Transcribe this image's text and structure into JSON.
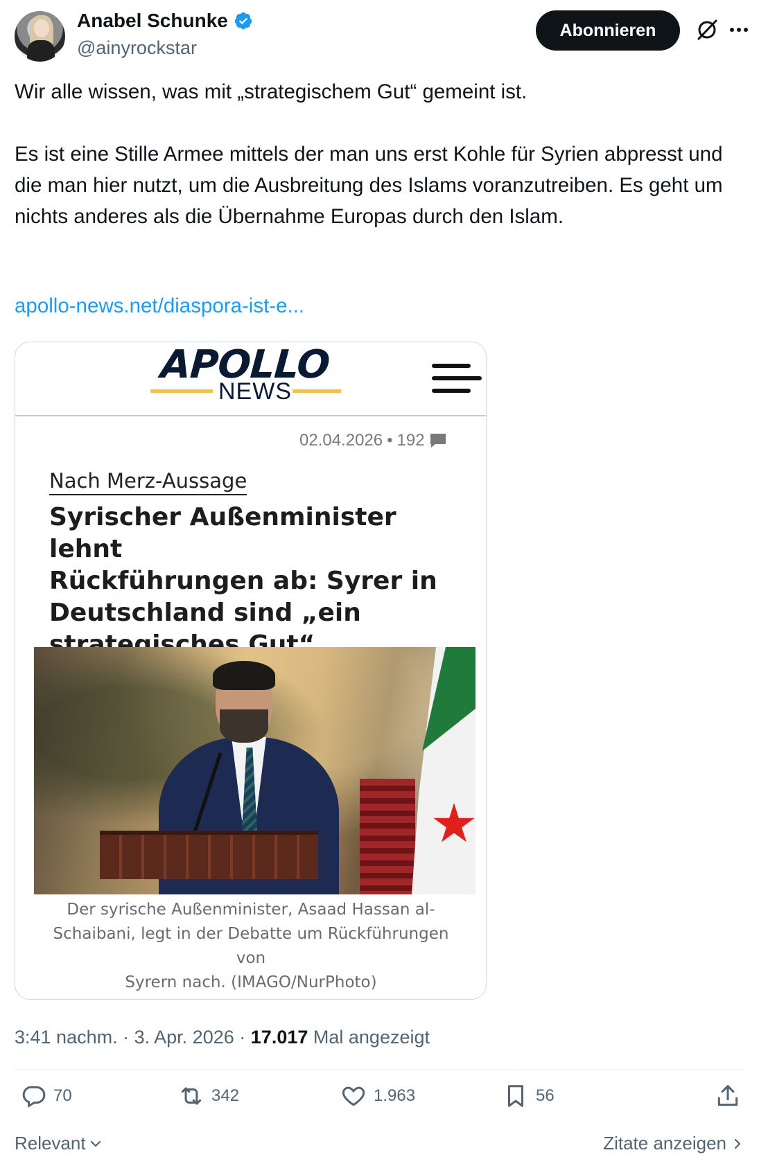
{
  "author": {
    "name": "Anabel Schunke",
    "handle": "@ainyrockstar",
    "verified": true
  },
  "header": {
    "subscribe_label": "Abonnieren",
    "grok_icon": "grok-slash-icon",
    "more_icon": "more-horizontal-icon"
  },
  "tweet": {
    "text": "Wir alle wissen, was mit „strategischem Gut“ gemeint ist.\n\nEs ist eine Stille Armee mittels der man uns erst Kohle für Syrien abpresst und die man hier nutzt, um die Ausbreitung des Islams voranzutreiben. Es geht um nichts anderes als die Übernahme Europas durch den Islam.",
    "link": "apollo-news.net/diaspora-ist-e..."
  },
  "card": {
    "logo_top": "APOLLO",
    "logo_bottom": "NEWS",
    "date": "02.04.2026",
    "separator": "•",
    "comments": "192",
    "kicker": "Nach Merz-Aussage",
    "headline": "Syrischer Außenminister lehnt\nRückführungen ab: Syrer in\nDeutschland sind „ein\nstrategisches Gut“",
    "caption": "Der syrische Außenminister, Asaad Hassan al-\nSchaibani, legt in der Debatte um Rückführungen von\nSyrern nach. (IMAGO/NurPhoto)"
  },
  "meta": {
    "time": "3:41 nachm.",
    "dot1": "·",
    "date": "3. Apr. 2026",
    "dot2": "·",
    "views": "17.017",
    "views_label": "Mal angezeigt"
  },
  "actions": {
    "replies": "70",
    "reposts": "342",
    "likes": "1.963",
    "bookmarks": "56"
  },
  "footer": {
    "sort_label": "Relevant",
    "quotes_label": "Zitate anzeigen"
  },
  "colors": {
    "accent": "#1d9bf0",
    "text": "#0f1419",
    "secondary": "#536471",
    "button": "#0f1419"
  }
}
